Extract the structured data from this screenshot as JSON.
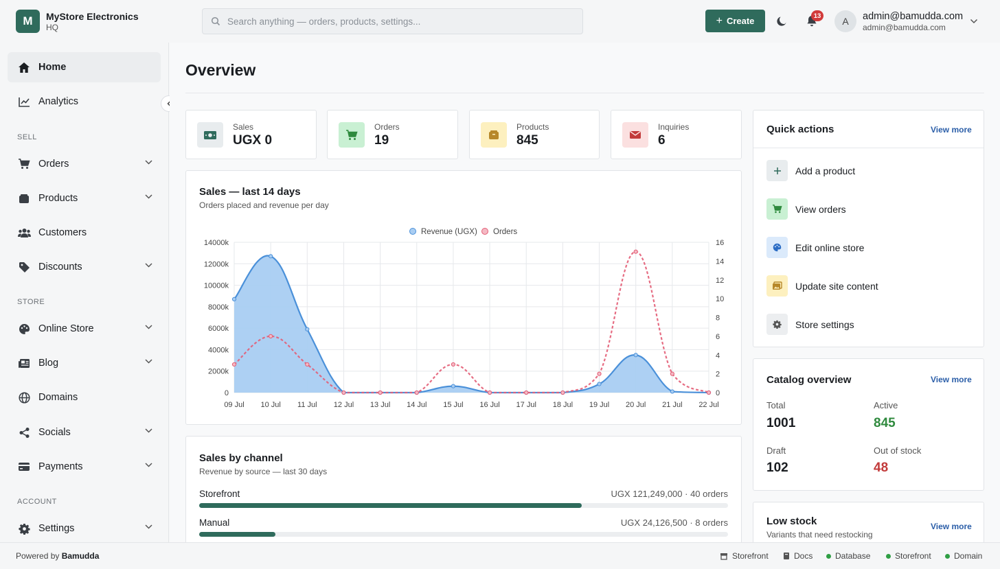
{
  "header": {
    "logo_letter": "M",
    "store_name": "MyStore Electronics",
    "store_sub": "HQ",
    "search_placeholder": "Search anything — orders, products, settings...",
    "create_label": "Create",
    "notification_count": "13",
    "avatar_letter": "A",
    "user_name": "admin@bamudda.com",
    "user_email": "admin@bamudda.com"
  },
  "sidebar": {
    "home": "Home",
    "analytics": "Analytics",
    "sell_section": "SELL",
    "orders": "Orders",
    "products": "Products",
    "customers": "Customers",
    "discounts": "Discounts",
    "store_section": "STORE",
    "online_store": "Online Store",
    "blog": "Blog",
    "domains": "Domains",
    "socials": "Socials",
    "payments": "Payments",
    "account_section": "ACCOUNT",
    "settings": "Settings"
  },
  "page_title": "Overview",
  "stats": {
    "sales_label": "Sales",
    "sales_value": "UGX 0",
    "orders_label": "Orders",
    "orders_value": "19",
    "products_label": "Products",
    "products_value": "845",
    "inquiries_label": "Inquiries",
    "inquiries_value": "6"
  },
  "sales_chart": {
    "title": "Sales — last 14 days",
    "subtitle": "Orders placed and revenue per day"
  },
  "chart_data": {
    "type": "line",
    "categories": [
      "09 Jul",
      "10 Jul",
      "11 Jul",
      "12 Jul",
      "13 Jul",
      "14 Jul",
      "15 Jul",
      "16 Jul",
      "17 Jul",
      "18 Jul",
      "19 Jul",
      "20 Jul",
      "21 Jul",
      "22 Jul"
    ],
    "series": [
      {
        "name": "Revenue (UGX)",
        "axis": "left",
        "style": "area",
        "color": "#4a90d9",
        "values": [
          8700,
          12700,
          5900,
          0,
          0,
          0,
          600,
          0,
          0,
          0,
          800,
          3500,
          100,
          0
        ]
      },
      {
        "name": "Orders",
        "axis": "right",
        "style": "dashed",
        "color": "#e35d75",
        "values": [
          3,
          6,
          3,
          0,
          0,
          0,
          3,
          0,
          0,
          0,
          2,
          15,
          2,
          0
        ]
      }
    ],
    "y_left": {
      "min": 0,
      "max": 14000,
      "ticks": [
        "0",
        "2000k",
        "4000k",
        "6000k",
        "8000k",
        "10000k",
        "12000k",
        "14000k"
      ]
    },
    "y_right": {
      "min": 0,
      "max": 16,
      "ticks": [
        "0",
        "2",
        "4",
        "6",
        "8",
        "10",
        "12",
        "14",
        "16"
      ]
    },
    "legend": "top-center",
    "grid": true
  },
  "channels": {
    "title": "Sales by channel",
    "subtitle": "Revenue by source — last 30 days",
    "items": [
      {
        "name": "Storefront",
        "value": "UGX 121,249,000 · 40 orders",
        "share": 0.724
      },
      {
        "name": "Manual",
        "value": "UGX 24,126,500 · 8 orders",
        "share": 0.144
      }
    ]
  },
  "quick_actions": {
    "title": "Quick actions",
    "view_more": "View more",
    "items": [
      {
        "label": "Add a product"
      },
      {
        "label": "View orders"
      },
      {
        "label": "Edit online store"
      },
      {
        "label": "Update site content"
      },
      {
        "label": "Store settings"
      }
    ]
  },
  "catalog": {
    "title": "Catalog overview",
    "view_more": "View more",
    "total_label": "Total",
    "total_value": "1001",
    "active_label": "Active",
    "active_value": "845",
    "draft_label": "Draft",
    "draft_value": "102",
    "oos_label": "Out of stock",
    "oos_value": "48",
    "active_color": "#2f8a3e",
    "oos_color": "#c23b3b"
  },
  "low_stock": {
    "title": "Low stock",
    "subtitle": "Variants that need restocking",
    "view_more": "View more"
  },
  "footer": {
    "powered_prefix": "Powered by",
    "powered_brand": "Bamudda",
    "storefront_link": "Storefront",
    "docs_link": "Docs",
    "status_database": "Database",
    "status_storefront": "Storefront",
    "status_domain": "Domain"
  }
}
